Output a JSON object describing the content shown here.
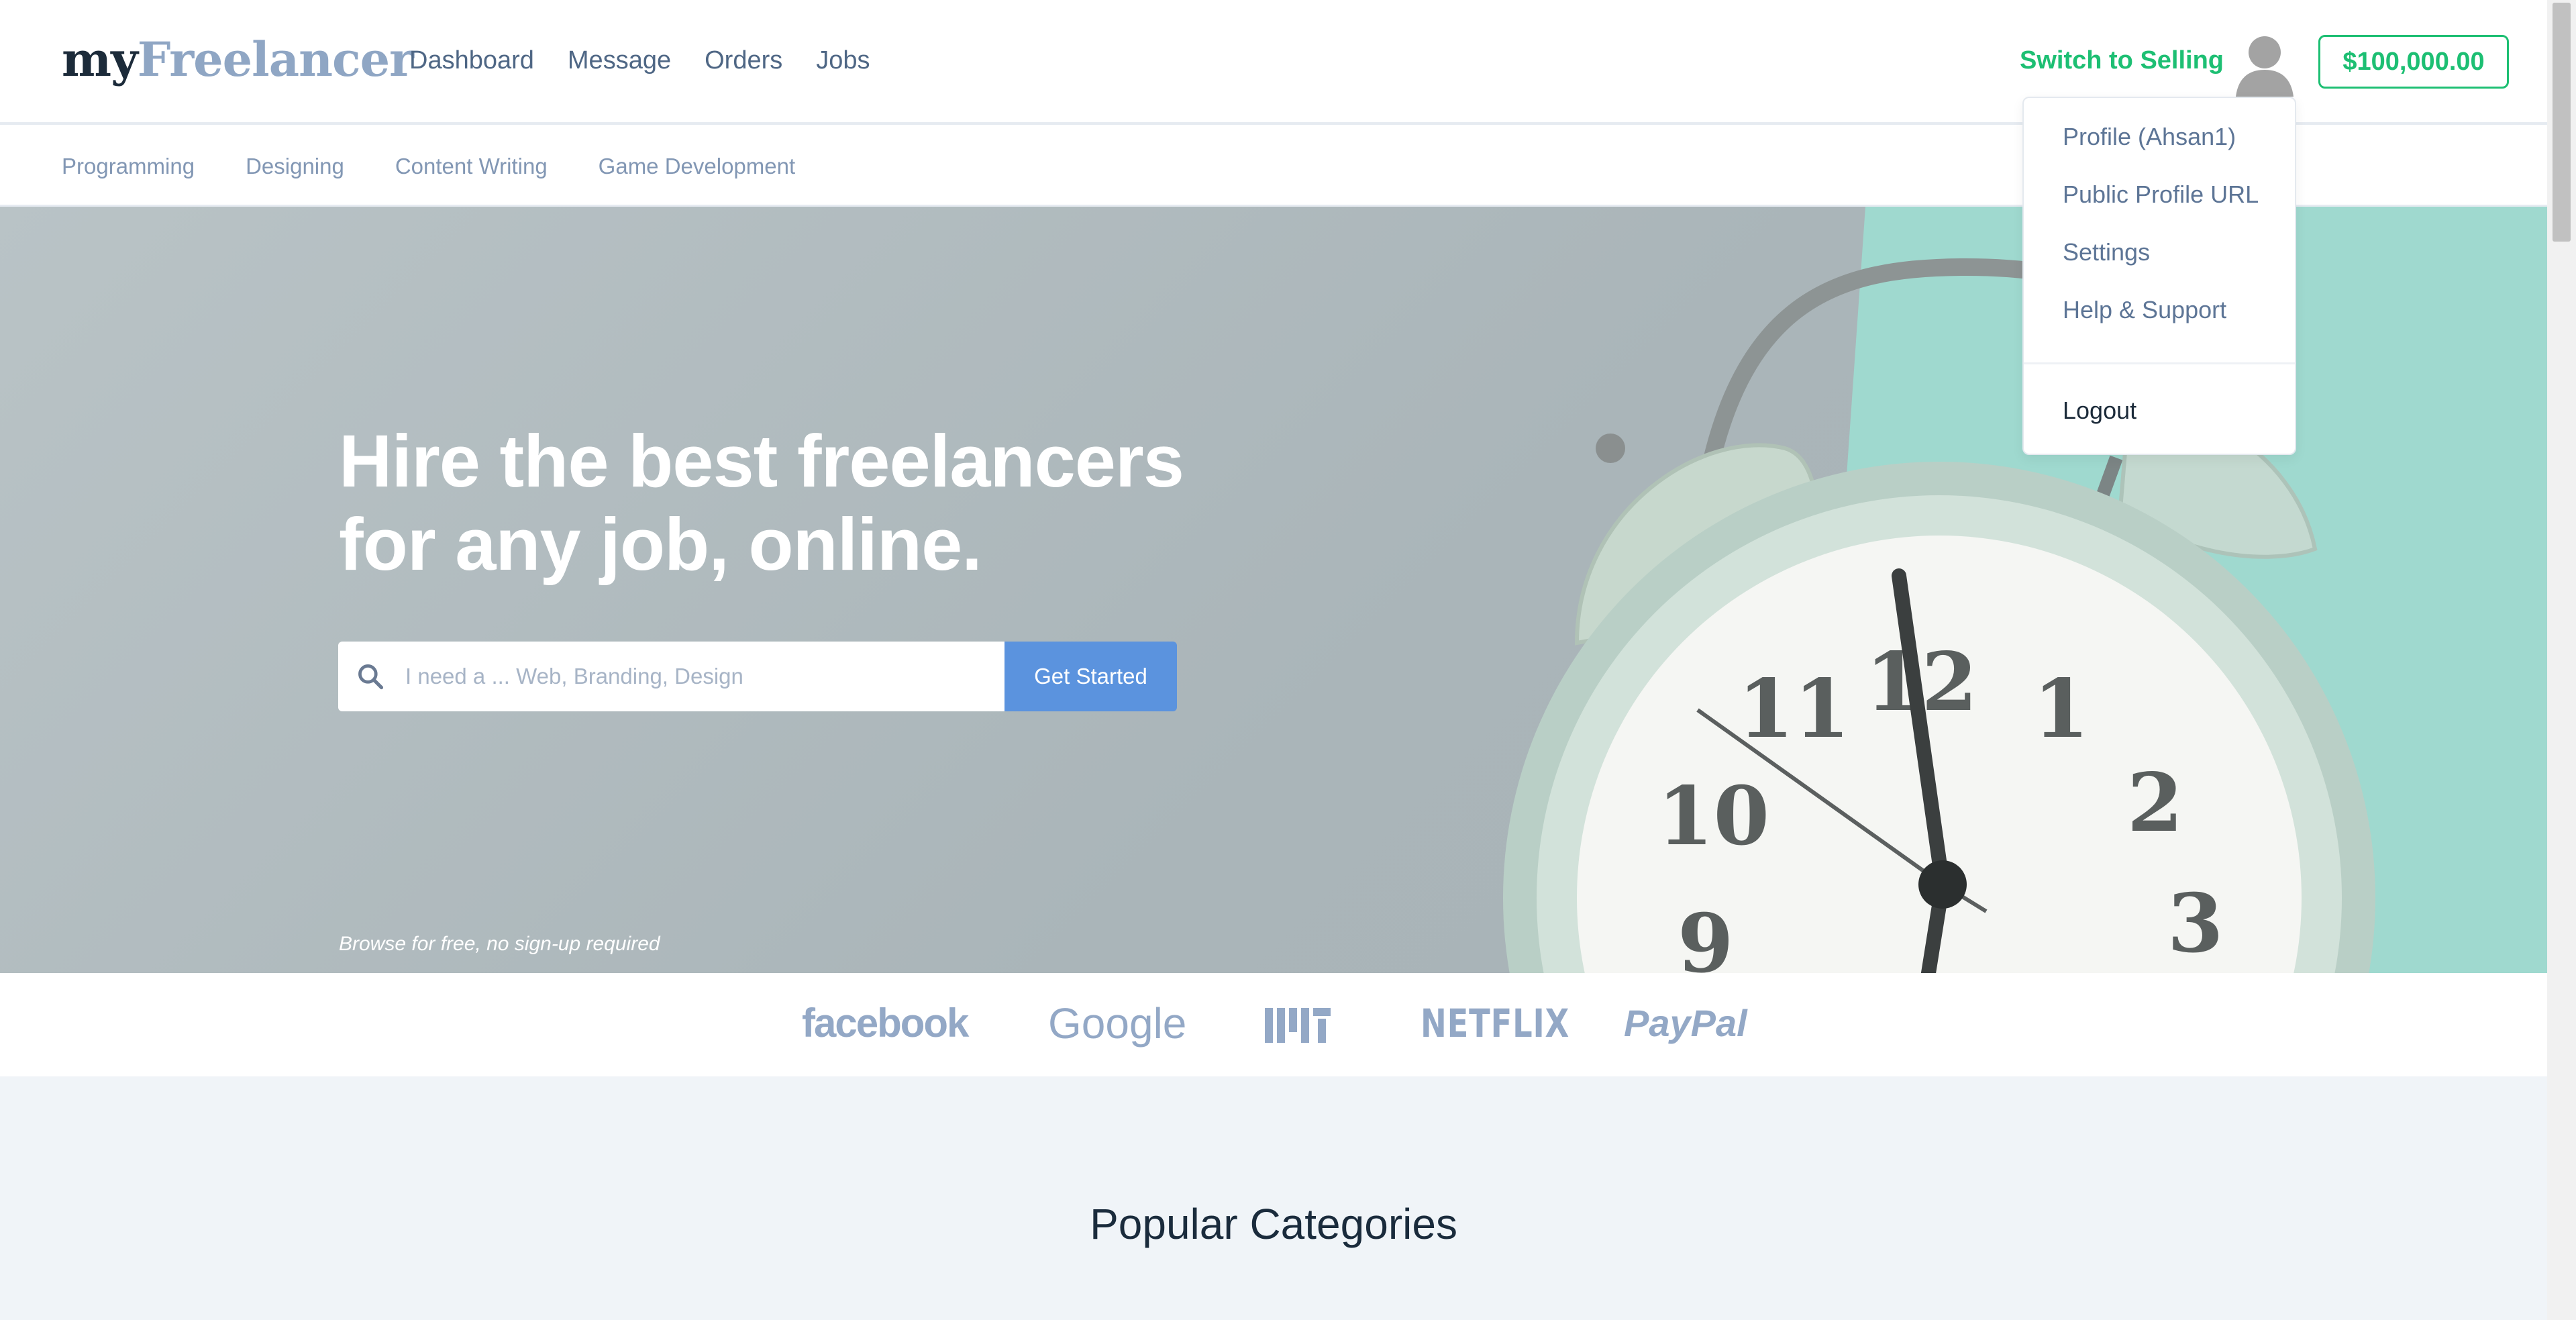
{
  "logo": {
    "part1": "my",
    "part2": "Freelancer"
  },
  "nav": {
    "items": [
      "Dashboard",
      "Message",
      "Orders",
      "Jobs"
    ]
  },
  "header": {
    "switch_label": "Switch to Selling",
    "balance": "$100,000.00"
  },
  "subnav": {
    "items": [
      "Programming",
      "Designing",
      "Content Writing",
      "Game Development"
    ]
  },
  "dropdown": {
    "items": [
      "Profile (Ahsan1)",
      "Public Profile URL",
      "Settings",
      "Help & Support"
    ],
    "logout": "Logout"
  },
  "hero": {
    "title_line1": "Hire the best freelancers",
    "title_line2": "for any job, online.",
    "search_placeholder": "I need a ... Web, Branding, Design",
    "button_label": "Get Started",
    "hint": "Browse for free, no sign-up required"
  },
  "brands": {
    "facebook": "facebook",
    "google": "Google",
    "netflix": "NETFLIX",
    "paypal": "PayPal"
  },
  "categories": {
    "title": "Popular Categories"
  },
  "colors": {
    "accent_green": "#1dbf73",
    "button_blue": "#5b93de",
    "logo_dark": "#1c2b3a",
    "logo_light": "#8fa6c4"
  }
}
